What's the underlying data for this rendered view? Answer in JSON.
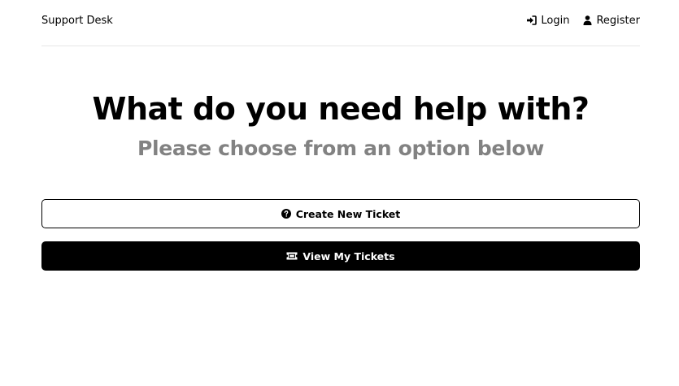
{
  "header": {
    "brand": "Support Desk",
    "nav": {
      "login": {
        "label": "Login",
        "icon": "sign-in-icon"
      },
      "register": {
        "label": "Register",
        "icon": "user-icon"
      }
    }
  },
  "hero": {
    "title": "What do you need help with?",
    "subtitle": "Please choose from an option below"
  },
  "actions": {
    "create_ticket": {
      "label": "Create New Ticket",
      "icon": "question-circle-icon"
    },
    "view_tickets": {
      "label": "View My Tickets",
      "icon": "ticket-icon"
    }
  },
  "colors": {
    "primary": "#000000",
    "background": "#ffffff",
    "subtitle": "#828282",
    "divider": "#e6e6e6"
  }
}
